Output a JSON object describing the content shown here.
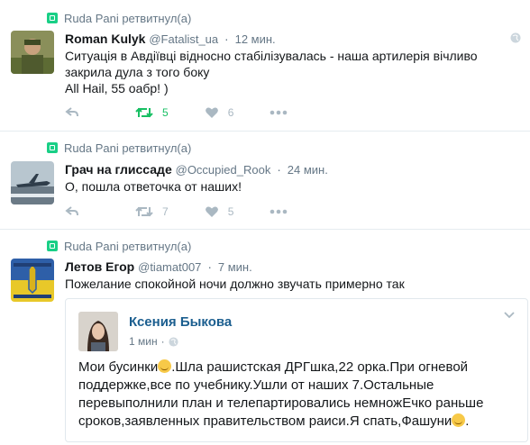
{
  "tweets": [
    {
      "retweeted_by": "Ruda Pani ретвитнул(а)",
      "name": "Roman Kulyk",
      "handle": "@Fatalist_ua",
      "time": "12 мин.",
      "text_line1": "Ситуація в Авдіївці відносно стабілізувалась - наша артилерія вічливо",
      "text_line2": "закрила дула з того боку",
      "text_line3": "All Hail, 55 оабр! )",
      "retweets": "5",
      "likes": "6",
      "avatar_icon": "soldier-avatar"
    },
    {
      "retweeted_by": "Ruda Pani ретвитнул(а)",
      "name": "Грач на глиссаде",
      "handle": "@Occupied_Rook",
      "time": "24 мин.",
      "text_line1": "О, пошла ответочка от наших!",
      "retweets": "7",
      "likes": "5",
      "avatar_icon": "aircraft-avatar"
    },
    {
      "retweeted_by": "Ruda Pani ретвитнул(а)",
      "name": "Летов Егор",
      "handle": "@tiamat007",
      "time": "7 мин.",
      "text_line1": "Пожелание спокойной ночи должно звучать примерно так",
      "avatar_icon": "ukraine-flag-avatar"
    }
  ],
  "quote": {
    "name": "Ксения Быкова",
    "time": "1 мин",
    "line1a": "Мои бусинки",
    "line1b": ".Шла рашистская ДРГшка,22 орка.При огневой",
    "line2": "поддержке,все по учебнику.Ушли от наших 7.Остальные",
    "line3": "перевыполнили план и телепартировались немножЕчко раньше",
    "line4a": "сроков,заявленных правительством раиси.Я спать,Фашуни",
    "line4b": "."
  },
  "colors": {
    "retweet_active": "#17bf63",
    "action_gray": "#aab8c2",
    "retweet_icon_bg": "#19cf86",
    "quote_name": "#1b5e8f"
  }
}
